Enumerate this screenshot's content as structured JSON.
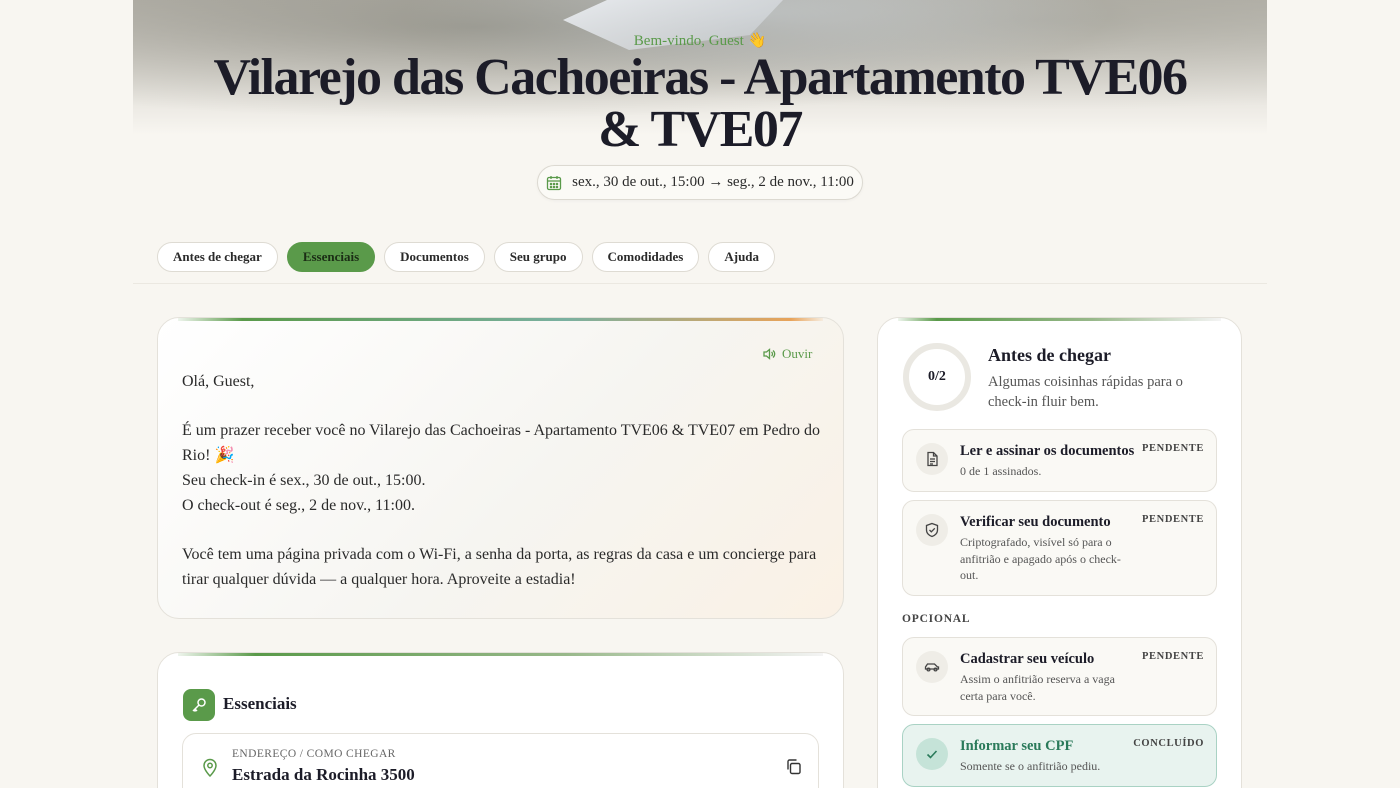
{
  "header": {
    "welcome": "Bem-vindo, Guest 👋",
    "title": "Vilarejo das Cachoeiras - Apartamento TVE06 & TVE07",
    "date_range": "sex., 30 de out., 15:00 → seg., 2 de nov., 11:00"
  },
  "tabs": [
    {
      "label": "Antes de chegar",
      "active": false
    },
    {
      "label": "Essenciais",
      "active": true
    },
    {
      "label": "Documentos",
      "active": false
    },
    {
      "label": "Seu grupo",
      "active": false
    },
    {
      "label": "Comodidades",
      "active": false
    },
    {
      "label": "Ajuda",
      "active": false
    }
  ],
  "message": {
    "listen_label": "Ouvir",
    "greeting": "Olá, Guest,",
    "line1": "É um prazer receber você no Vilarejo das Cachoeiras - Apartamento TVE06 & TVE07 em Pedro do Rio! 🎉",
    "line2": "Seu check-in é sex., 30 de out., 15:00.",
    "line3": "O check-out é seg., 2 de nov., 11:00.",
    "closing": "Você tem uma página privada com o Wi-Fi, a senha da porta, as regras da casa e um concierge para tirar qualquer dúvida — a qualquer hora. Aproveite a estadia!"
  },
  "essentials": {
    "title": "Essenciais",
    "address_label": "ENDEREÇO / COMO CHEGAR",
    "address_value": "Estrada da Rocinha 3500"
  },
  "checklist": {
    "progress": "0/2",
    "progress_fraction": 0,
    "title": "Antes de chegar",
    "subtitle": "Algumas coisinhas rápidas para o check-in fluir bem.",
    "optional_label": "OPCIONAL",
    "tasks": [
      {
        "icon": "document-icon",
        "name": "Ler e assinar os documentos",
        "desc": "0 de 1 assinados.",
        "status": "PENDENTE"
      },
      {
        "icon": "shield-icon",
        "name": "Verificar seu documento",
        "desc": "Criptografado, visível só para o anfitrião e apagado após o check-out.",
        "status": "PENDENTE"
      },
      {
        "icon": "car-icon",
        "name": "Cadastrar seu veículo",
        "desc": "Assim o anfitrião reserva a vaga certa para você.",
        "status": "PENDENTE"
      },
      {
        "icon": "check-icon",
        "name": "Informar seu CPF",
        "desc": "Somente se o anfitrião pediu.",
        "status": "CONCLUÍDO"
      }
    ]
  },
  "colors": {
    "accent": "#5a9a4a",
    "done": "#2a7a5a",
    "background": "#f8f6f1"
  }
}
